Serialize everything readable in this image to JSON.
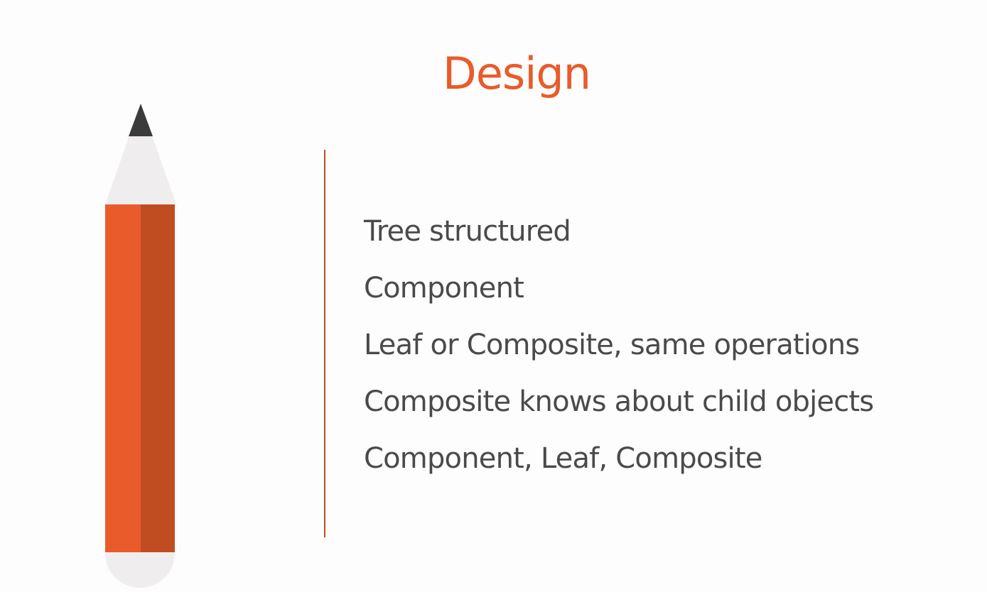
{
  "slide": {
    "title": "Design",
    "bullets": [
      "Tree structured",
      "Component",
      "Leaf or Composite, same operations",
      "Composite knows about child objects",
      "Component, Leaf, Composite"
    ]
  },
  "colors": {
    "background": "#fdfdfd",
    "accent_orange": "#e95b2a",
    "accent_orange_dark": "#c04d21",
    "text_gray": "#4a4a4a",
    "pencil_tip": "#3b3b3b",
    "pencil_wood": "#efedee"
  },
  "icons": {
    "pencil": "pencil-icon"
  }
}
